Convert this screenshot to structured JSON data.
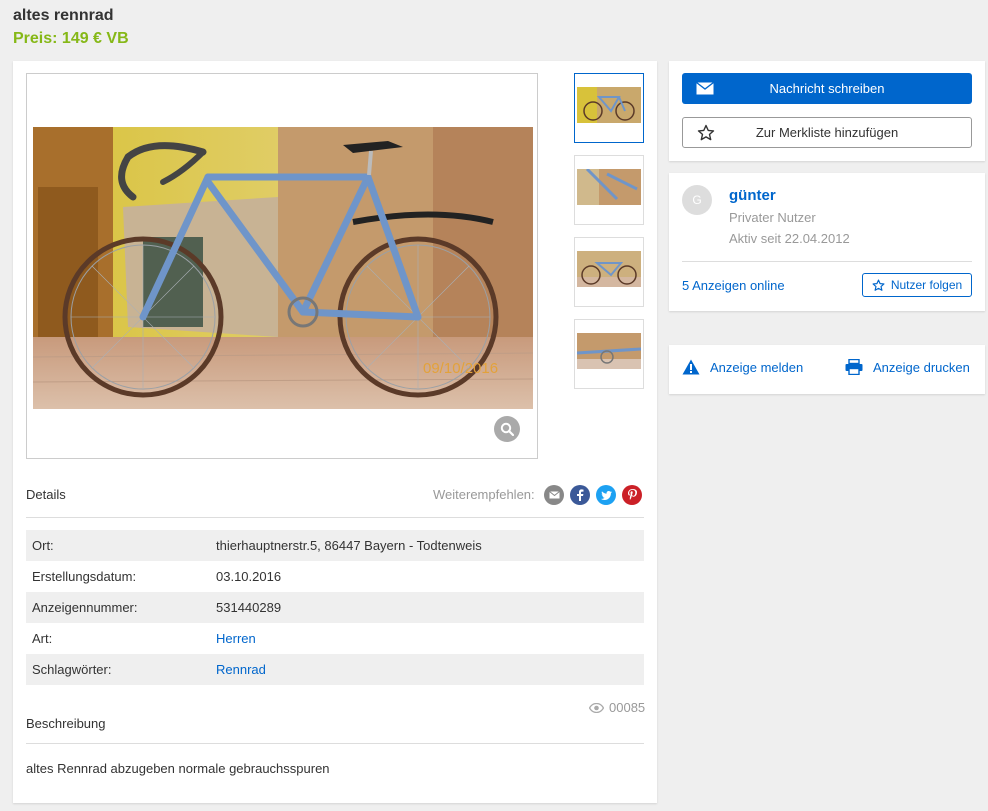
{
  "listing": {
    "title": "altes rennrad",
    "price": "Preis: 149 € VB",
    "image_stamp": "09/10/2016"
  },
  "gallery": {
    "zoom_icon": "magnifier-icon",
    "thumbnail_count": 4
  },
  "details": {
    "heading": "Details",
    "share_label": "Weiterempfehlen:",
    "share_icons": [
      "email-icon",
      "facebook-icon",
      "twitter-icon",
      "pinterest-icon"
    ],
    "rows": [
      {
        "label": "Ort:",
        "value": "thierhauptnerstr.5, 86447 Bayern - Todtenweis"
      },
      {
        "label": "Erstellungsdatum:",
        "value": "03.10.2016"
      },
      {
        "label": "Anzeigennummer:",
        "value": "531440289"
      },
      {
        "label": "Art:",
        "value": "Herren"
      },
      {
        "label": "Schlagwörter:",
        "value": "Rennrad"
      }
    ]
  },
  "views": "00085",
  "description": {
    "heading": "Beschreibung",
    "text": "altes Rennrad abzugeben normale gebrauchsspuren"
  },
  "contact": {
    "message_button": "Nachricht schreiben",
    "watchlist_button": "Zur Merkliste hinzufügen"
  },
  "seller": {
    "avatar_initial": "G",
    "name": "günter",
    "type": "Privater Nutzer",
    "active_since": "Aktiv seit 22.04.2012",
    "ads_online": "5 Anzeigen online",
    "follow_button": "Nutzer folgen"
  },
  "actions": {
    "report": "Anzeige melden",
    "print": "Anzeige drucken"
  },
  "colors": {
    "brand_blue": "#0066cc",
    "price_green": "#86b817"
  }
}
